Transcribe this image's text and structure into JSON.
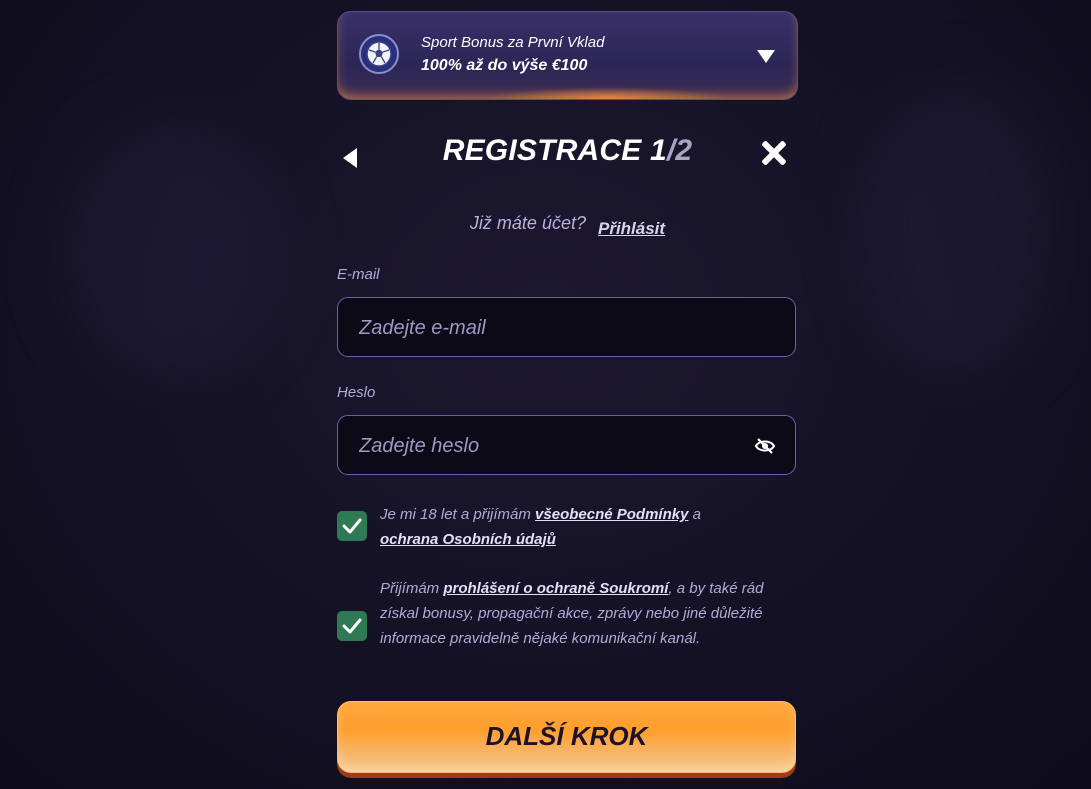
{
  "bonus": {
    "line1": "Sport Bonus za První Vklad",
    "line2": "100% až do výše €100",
    "icon": "football-icon"
  },
  "header": {
    "title_main": "REGISTRACE 1",
    "title_slash": "/2"
  },
  "login_prompt": {
    "text": "Již máte účet?",
    "link": "Přihlásit"
  },
  "email": {
    "label": "E-mail",
    "placeholder": "Zadejte e-mail"
  },
  "password": {
    "label": "Heslo",
    "placeholder": "Zadejte heslo"
  },
  "consent1": {
    "checked": true,
    "text1": "Je mi 18 let a přijímám ",
    "link1": "všeobecné Podmínky",
    "text2": " a ",
    "link2": "ochrana Osobních údajů"
  },
  "consent2": {
    "checked": true,
    "text1": "Přijímám ",
    "link1": "prohlášení o ochraně Soukromí",
    "text2": ", a by také rád získal bonusy, propagační akce, zprávy nebo jiné důležité informace pravidelně nějaké komunikační kanál."
  },
  "cta": {
    "label": "DALŠÍ KROK"
  },
  "colors": {
    "accent_orange": "#ff9f2e",
    "check_green": "#2f7a55",
    "border_purple": "#6a5fa8"
  }
}
